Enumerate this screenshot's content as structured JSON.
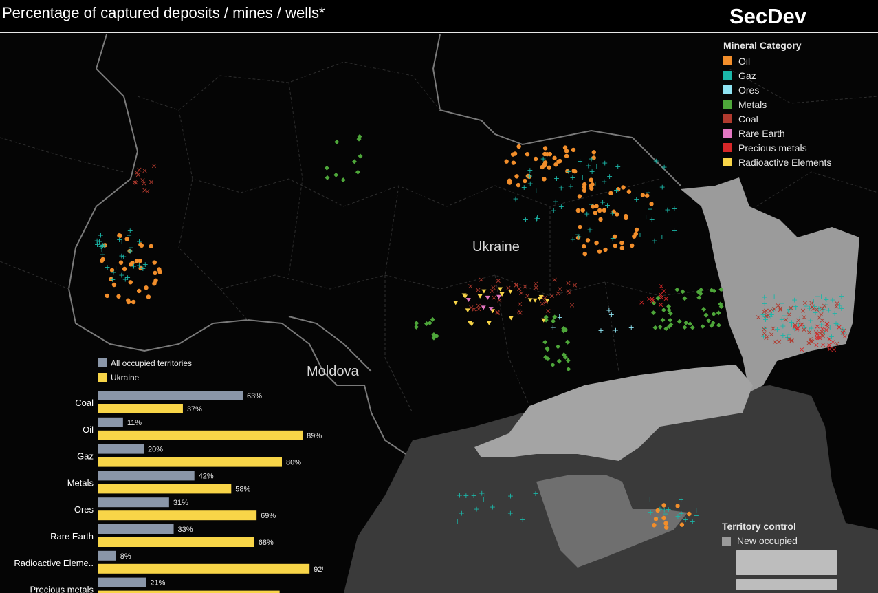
{
  "header": {
    "title": "Percentage of captured deposits / mines / wells*",
    "logo": "SecDev"
  },
  "map": {
    "labels": {
      "country": "Ukraine",
      "neighbor": "Moldova"
    }
  },
  "legend": {
    "title": "Mineral Category",
    "items": [
      {
        "label": "Oil",
        "color": "#f28e2b"
      },
      {
        "label": "Gaz",
        "color": "#1bb6a8"
      },
      {
        "label": "Ores",
        "color": "#8fe3f2"
      },
      {
        "label": "Metals",
        "color": "#4ea73a"
      },
      {
        "label": "Coal",
        "color": "#b03a2e"
      },
      {
        "label": "Rare Earth",
        "color": "#e377c2"
      },
      {
        "label": "Precious metals",
        "color": "#d62728"
      },
      {
        "label": "Radioactive Elements",
        "color": "#f8d548"
      }
    ]
  },
  "territory": {
    "title": "Territory control",
    "items": [
      {
        "label": "New occupied",
        "color": "#9a9a9a"
      }
    ]
  },
  "chart_data": {
    "type": "bar",
    "orientation": "horizontal",
    "categories": [
      "Coal",
      "Oil",
      "Gaz",
      "Metals",
      "Ores",
      "Rare Earth",
      "Radioactive Eleme..",
      "Precious metals"
    ],
    "series": [
      {
        "name": "All occupied territories",
        "color": "#8a96a8",
        "values": [
          63,
          11,
          20,
          42,
          31,
          33,
          8,
          21
        ]
      },
      {
        "name": "Ukraine",
        "color": "#f8d548",
        "values": [
          37,
          89,
          80,
          58,
          69,
          68,
          92,
          79
        ]
      }
    ],
    "value_suffix": "%",
    "xlim": [
      0,
      100
    ]
  }
}
